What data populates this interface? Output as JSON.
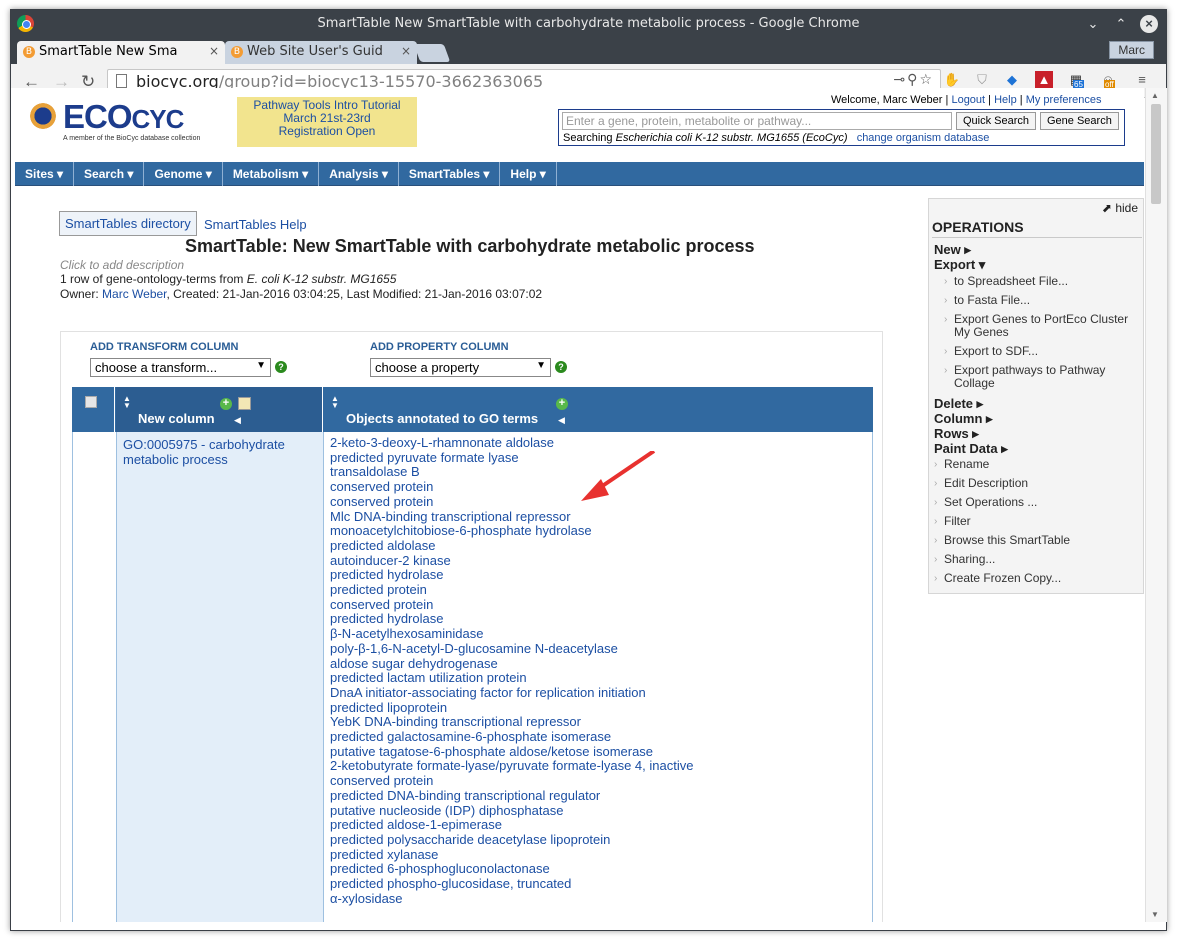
{
  "window": {
    "title": "SmartTable New SmartTable with carbohydrate metabolic process - Google Chrome",
    "tabs": [
      {
        "label": "SmartTable New Sma"
      },
      {
        "label": "Web Site User's Guid"
      }
    ],
    "profile": "Marc",
    "url_host": "biocyc.org",
    "url_path": "/group?id=biocyc13-15570-3662363065",
    "ext_badges": {
      "b65": "65",
      "off": "off"
    }
  },
  "header": {
    "logo_word_a": "ECO",
    "logo_word_b": "CYC",
    "logo_tag": "A member of the BioCyc database collection",
    "promo": [
      "Pathway Tools Intro Tutorial",
      "March 21st-23rd",
      "Registration Open"
    ],
    "welcome": "Welcome, Marc Weber",
    "links": [
      "Logout",
      "Help",
      "My preferences"
    ],
    "search_placeholder": "Enter a gene, protein, metabolite or pathway...",
    "quick_search": "Quick Search",
    "gene_search": "Gene Search",
    "searching_prefix": "Searching",
    "searching_org": "Escherichia coli K-12 substr. MG1655 (EcoCyc)",
    "change_org": "change organism database"
  },
  "navbar": [
    "Sites",
    "Search",
    "Genome",
    "Metabolism",
    "Analysis",
    "SmartTables",
    "Help"
  ],
  "smarttable": {
    "directory_btn": "SmartTables directory",
    "help_link": "SmartTables Help",
    "title": "SmartTable: New SmartTable with carbohydrate metabolic process",
    "description": "Click to add description",
    "rows_prefix": "1 row of gene-ontology-terms from",
    "rows_org": "E. coli K-12 substr. MG1655",
    "owner_label": "Owner:",
    "owner": "Marc Weber",
    "dates": ", Created: 21-Jan-2016 03:04:25, Last Modified: 21-Jan-2016 03:07:02",
    "add_transform_label": "ADD TRANSFORM COLUMN",
    "transform_select": "choose a transform...",
    "add_property_label": "ADD PROPERTY COLUMN",
    "property_select": "choose a property",
    "col1_header": "New column",
    "col2_header": "Objects annotated to GO terms",
    "col1_value": "GO:0005975 - carbohydrate metabolic process",
    "objects": [
      "2-keto-3-deoxy-L-rhamnonate aldolase",
      "predicted pyruvate formate lyase",
      "transaldolase B",
      "conserved protein",
      "conserved protein",
      "Mlc DNA-binding transcriptional repressor",
      "monoacetylchitobiose-6-phosphate hydrolase",
      "predicted aldolase",
      "autoinducer-2 kinase",
      "predicted hydrolase",
      "predicted protein",
      "conserved protein",
      "predicted hydrolase",
      "β-N-acetylhexosaminidase",
      "poly-β-1,6-N-acetyl-D-glucosamine N-deacetylase",
      "aldose sugar dehydrogenase",
      "predicted lactam utilization protein",
      "DnaA initiator-associating factor for replication initiation",
      "predicted lipoprotein",
      "YebK DNA-binding transcriptional repressor",
      "predicted galactosamine-6-phosphate isomerase",
      "putative tagatose-6-phosphate aldose/ketose isomerase",
      "2-ketobutyrate formate-lyase/pyruvate formate-lyase 4, inactive",
      "conserved protein",
      "predicted DNA-binding transcriptional regulator",
      "putative nucleoside (IDP) diphosphatase",
      "predicted aldose-1-epimerase",
      "predicted polysaccharide deacetylase lipoprotein",
      "predicted xylanase",
      "predicted 6-phosphogluconolactonase",
      "predicted phospho-glucosidase, truncated",
      "α-xylosidase"
    ]
  },
  "operations": {
    "hide": "hide",
    "header": "OPERATIONS",
    "new": "New",
    "export": "Export",
    "export_items": [
      "to Spreadsheet File...",
      "to Fasta File...",
      "Export Genes to PortEco Cluster My Genes",
      "Export to SDF...",
      "Export pathways to Pathway Collage"
    ],
    "delete": "Delete",
    "column": "Column",
    "rows": "Rows",
    "paint": "Paint Data",
    "actions": [
      "Rename",
      "Edit Description",
      "Set Operations ...",
      "Filter",
      "Browse this SmartTable",
      "Sharing...",
      "Create Frozen Copy..."
    ]
  }
}
